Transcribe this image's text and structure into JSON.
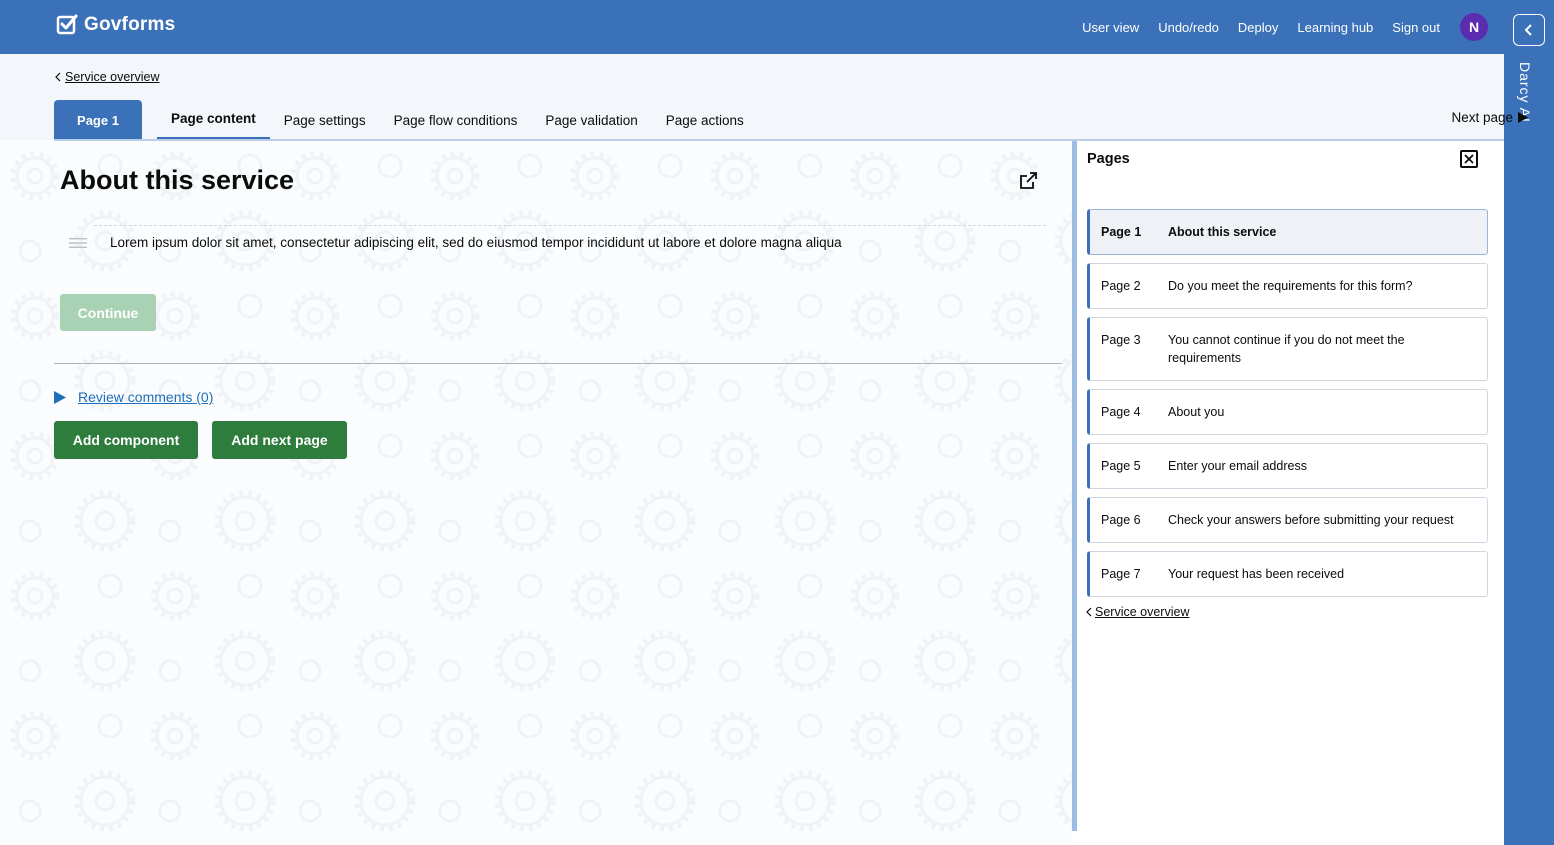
{
  "header": {
    "brand": "Govforms",
    "nav": [
      "User view",
      "Undo/redo",
      "Deploy",
      "Learning hub",
      "Sign out"
    ],
    "avatar_initial": "N",
    "brand_color": "#3b71b8",
    "avatar_color": "#5b2bb0"
  },
  "assistant": {
    "label": "Darcy AI"
  },
  "breadcrumb": {
    "label": "Service overview"
  },
  "tabs": {
    "page_label": "Page 1",
    "items": [
      "Page content",
      "Page settings",
      "Page flow conditions",
      "Page validation",
      "Page actions"
    ],
    "active": "Page content",
    "next_page": "Next page"
  },
  "editor": {
    "title": "About this service",
    "body_text": "Lorem ipsum dolor sit amet, consectetur adipiscing elit, sed do eiusmod tempor incididunt ut labore et dolore magna aliqua",
    "continue_label": "Continue",
    "review_comments": "Review comments (0)",
    "add_component": "Add component",
    "add_next_page": "Add next page",
    "button_color": "#2e7d3c"
  },
  "pages_panel": {
    "title": "Pages",
    "pages": [
      {
        "number": "Page 1",
        "name": "About this service"
      },
      {
        "number": "Page 2",
        "name": "Do you meet the requirements for this form?"
      },
      {
        "number": "Page 3",
        "name": "You cannot continue if you do not meet the requirements"
      },
      {
        "number": "Page 4",
        "name": "About you"
      },
      {
        "number": "Page 5",
        "name": "Enter your email address"
      },
      {
        "number": "Page 6",
        "name": "Check your answers before submitting your request"
      },
      {
        "number": "Page 7",
        "name": "Your request has been received"
      }
    ],
    "selected": "Page 1",
    "back_link": "Service overview"
  }
}
